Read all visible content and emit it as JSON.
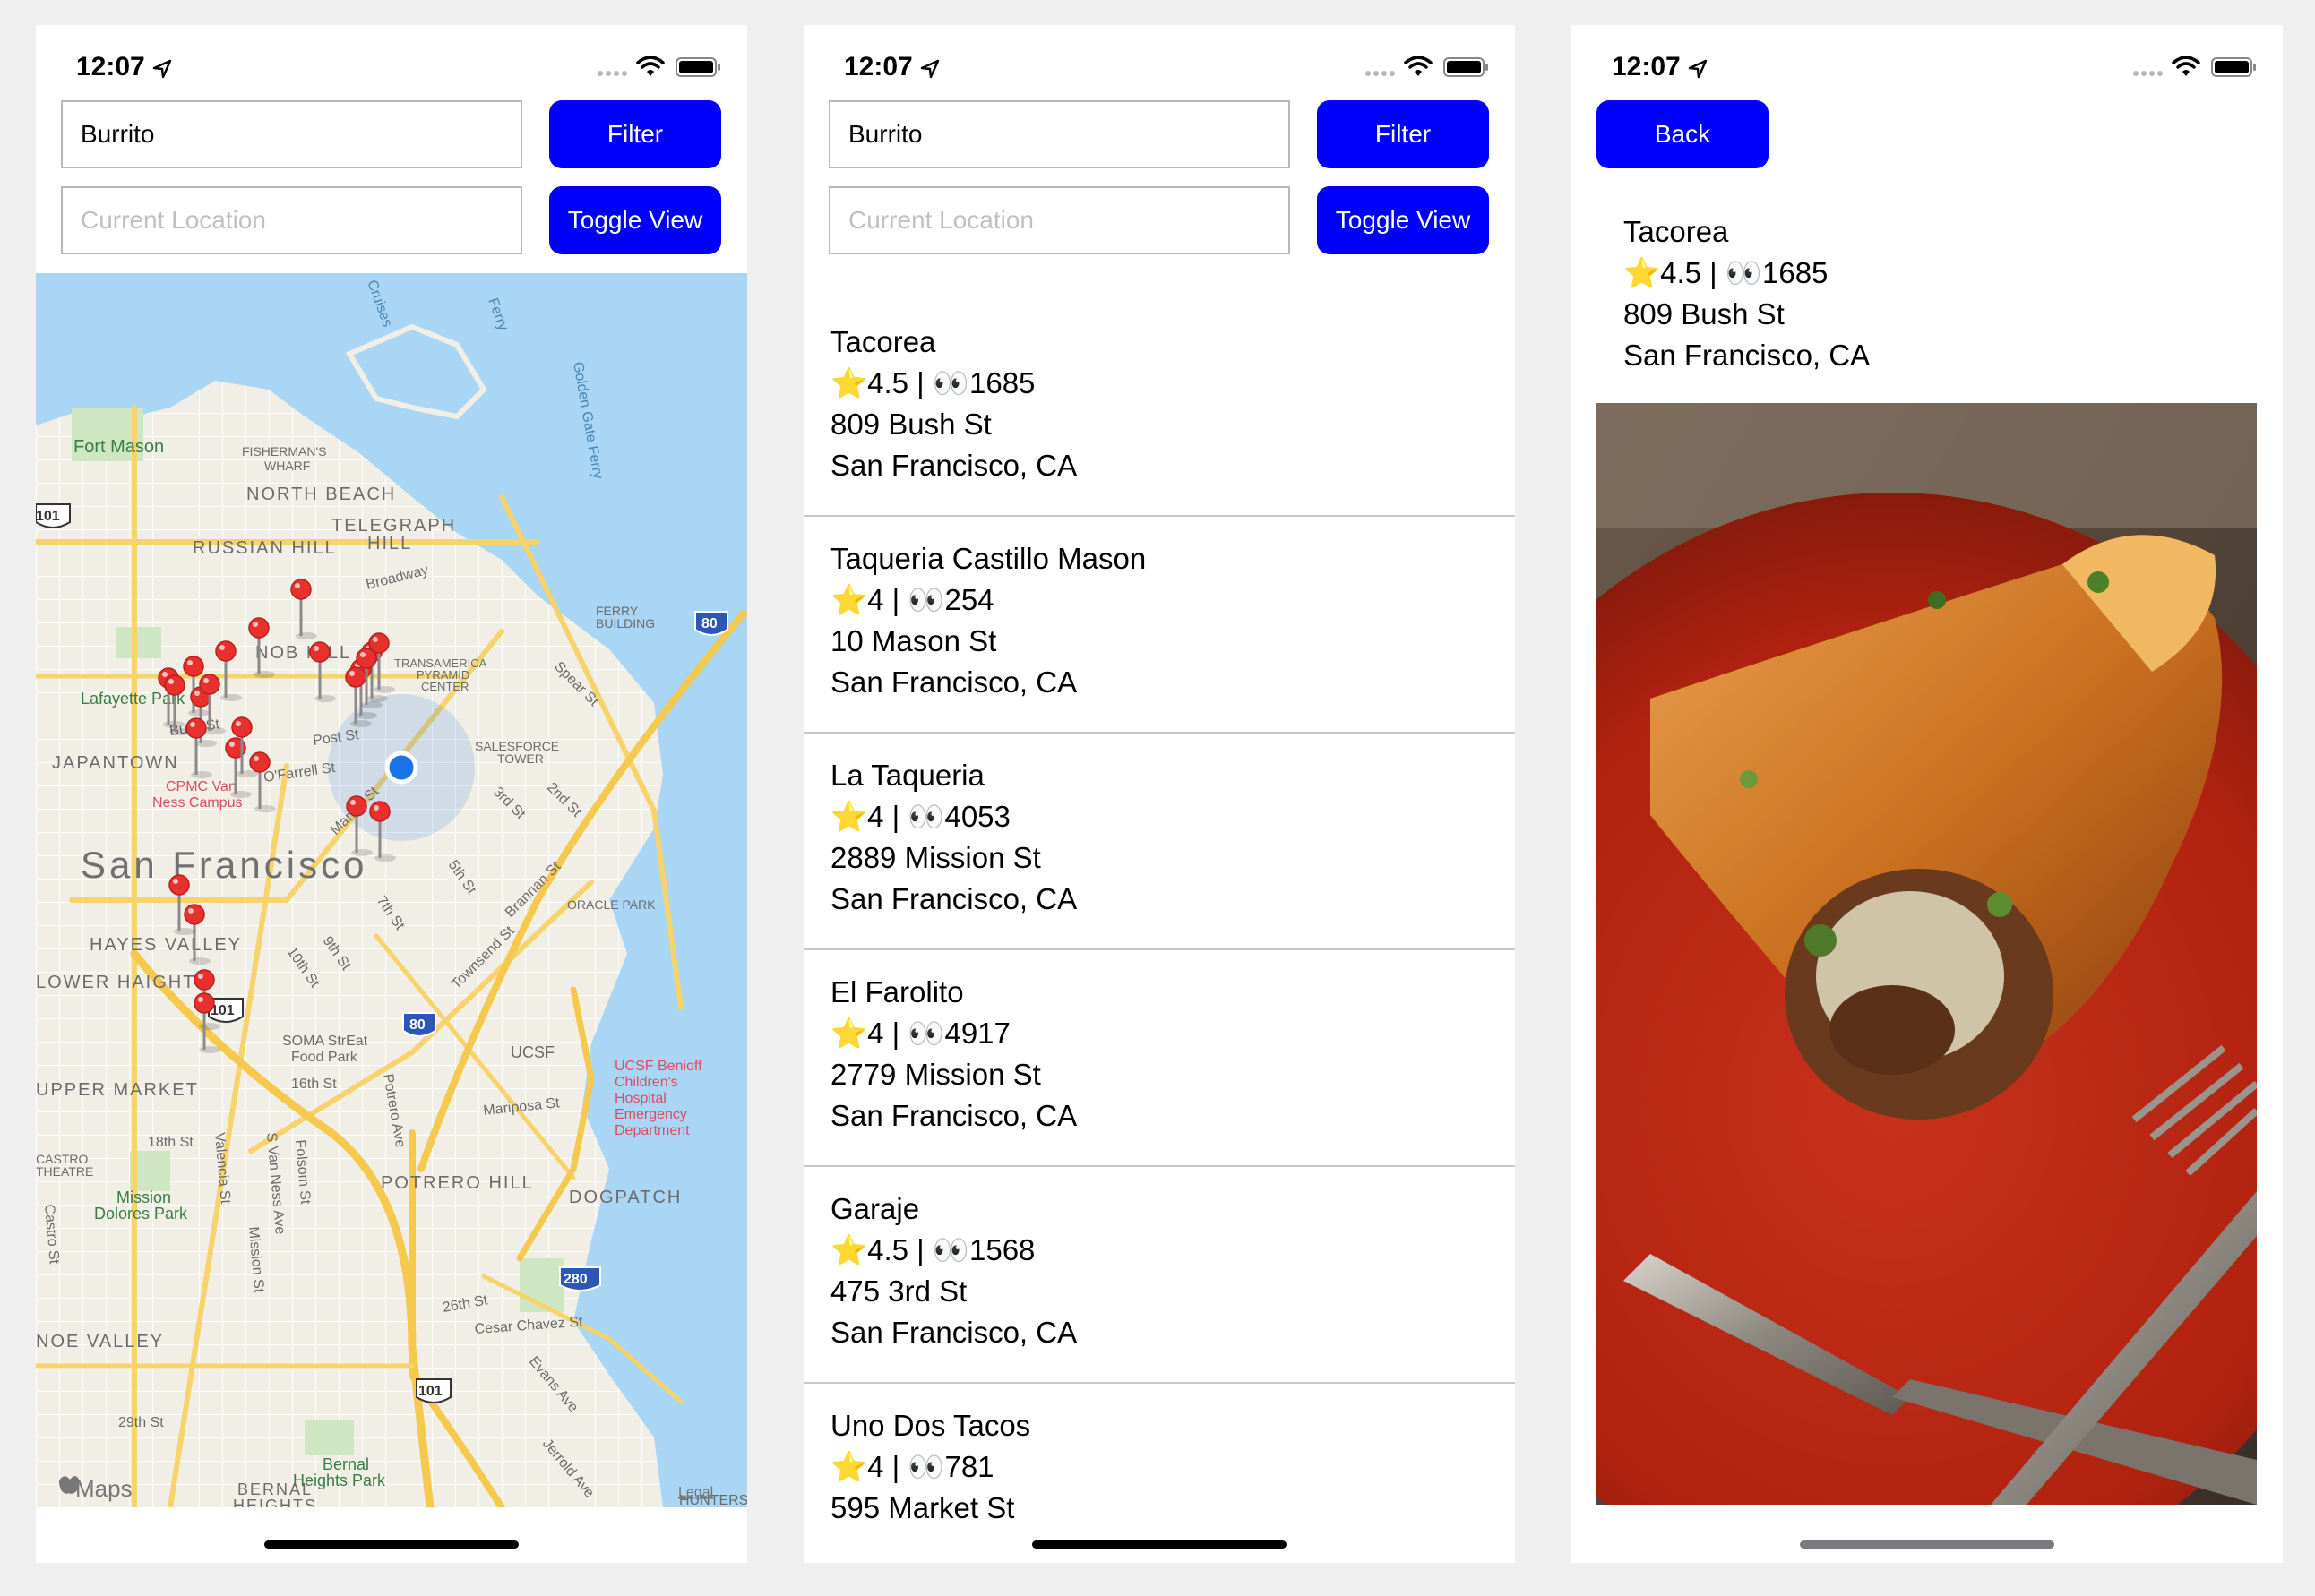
{
  "status_bar": {
    "time": "12:07"
  },
  "search": {
    "query": "Burrito",
    "location_placeholder": "Current Location",
    "filter_label": "Filter",
    "toggle_label": "Toggle View",
    "back_label": "Back"
  },
  "map": {
    "city_label": "San Francisco",
    "attribution": "Maps",
    "legal": "Legal",
    "labels": {
      "fort_mason": "Fort Mason",
      "fishermans_wharf_1": "FISHERMAN'S",
      "fishermans_wharf_2": "WHARF",
      "north_beach": "NORTH BEACH",
      "telegraph_hill_1": "TELEGRAPH",
      "telegraph_hill_2": "HILL",
      "russian_hill": "RUSSIAN HILL",
      "broadway": "Broadway",
      "nob_hill": "NOB HILL",
      "ferry_building_1": "FERRY",
      "ferry_building_2": "BUILDING",
      "transamerica_1": "TRANSAMERICA",
      "transamerica_2": "PYRAMID",
      "transamerica_3": "CENTER",
      "lafayette_park": "Lafayette Park",
      "bush_st": "Bush St",
      "post_st": "Post St",
      "japantown": "JAPANTOWN",
      "cpmc_1": "CPMC Van",
      "cpmc_2": "Ness Campus",
      "salesforce_1": "SALESFORCE",
      "salesforce_2": "TOWER",
      "ofarrell": "O'Farrell St",
      "market_st": "Market St",
      "third_st": "3rd St",
      "second_st": "2nd St",
      "spear_st": "Spear St",
      "hayes_valley": "HAYES VALLEY",
      "lower_haight": "LOWER HAIGHT",
      "fifth_st": "5th St",
      "seventh_st": "7th St",
      "ninth_st": "9th St",
      "tenth_st": "10th St",
      "brannan_st": "Brannan St",
      "townsend_st": "Townsend St",
      "oracle_park": "ORACLE PARK",
      "soma_1": "SOMA StrEat",
      "soma_2": "Food Park",
      "sixteenth_st": "16th St",
      "upper_market": "UPPER MARKET",
      "ucsf": "UCSF",
      "ucsf_benioff_1": "UCSF Benioff",
      "ucsf_benioff_2": "Children's",
      "ucsf_benioff_3": "Hospital",
      "ucsf_benioff_4": "Emergency",
      "ucsf_benioff_5": "Department",
      "mariposa_st": "Mariposa St",
      "potrero_ave": "Potrero Ave",
      "eighteenth_st": "18th St",
      "valencia_st": "Valencia St",
      "s_van_ness": "S Van Ness Ave",
      "folsom_st": "Folsom St",
      "castro_theatre_1": "CASTRO",
      "castro_theatre_2": "THEATRE",
      "castro_st": "Castro St",
      "mission_dolores_1": "Mission",
      "mission_dolores_2": "Dolores Park",
      "potrero_hill": "POTRERO HILL",
      "dogpatch": "DOGPATCH",
      "mission_st": "Mission St",
      "twentysixth_st": "26th St",
      "cesar_chavez": "Cesar Chavez St",
      "noe_valley": "NOE VALLEY",
      "evans_ave": "Evans Ave",
      "twentyninth_st": "29th St",
      "bernal_1": "Bernal",
      "bernal_2": "Heights Park",
      "bernal_heights_1": "BERNAL",
      "bernal_heights_2": "HEIGHTS",
      "jerrold_ave": "Jerrold Ave",
      "hunters_point": "HUNTERS POINT",
      "route_101": "101",
      "route_80": "80",
      "route_280": "280",
      "golden_gate_ferry": "Golden Gate Ferry",
      "ferry": "Ferry",
      "cruises": "Cruises"
    }
  },
  "results": [
    {
      "name": "Tacorea",
      "rating": "4.5",
      "reviews": "1685",
      "address": "809 Bush St",
      "city": "San Francisco, CA"
    },
    {
      "name": "Taqueria Castillo Mason",
      "rating": "4",
      "reviews": "254",
      "address": "10 Mason St",
      "city": "San Francisco, CA"
    },
    {
      "name": "La Taqueria",
      "rating": "4",
      "reviews": "4053",
      "address": "2889 Mission St",
      "city": "San Francisco, CA"
    },
    {
      "name": "El Farolito",
      "rating": "4",
      "reviews": "4917",
      "address": "2779 Mission St",
      "city": "San Francisco, CA"
    },
    {
      "name": "Garaje",
      "rating": "4.5",
      "reviews": "1568",
      "address": "475 3rd St",
      "city": "San Francisco, CA"
    },
    {
      "name": "Uno Dos Tacos",
      "rating": "4",
      "reviews": "781",
      "address": "595 Market St",
      "city": "San Francisco, CA"
    }
  ],
  "detail": {
    "name": "Tacorea",
    "rating": "4.5",
    "reviews": "1685",
    "address": "809 Bush St",
    "city": "San Francisco, CA"
  },
  "icons": {
    "star": "star-icon",
    "eyes": "eyes-icon",
    "pin": "map-pin-icon",
    "user_location": "user-location-icon"
  },
  "colors": {
    "button": "#0000ff",
    "pin": "#e8302d",
    "user_dot": "#1a73e8",
    "water": "#a9d6f5"
  }
}
